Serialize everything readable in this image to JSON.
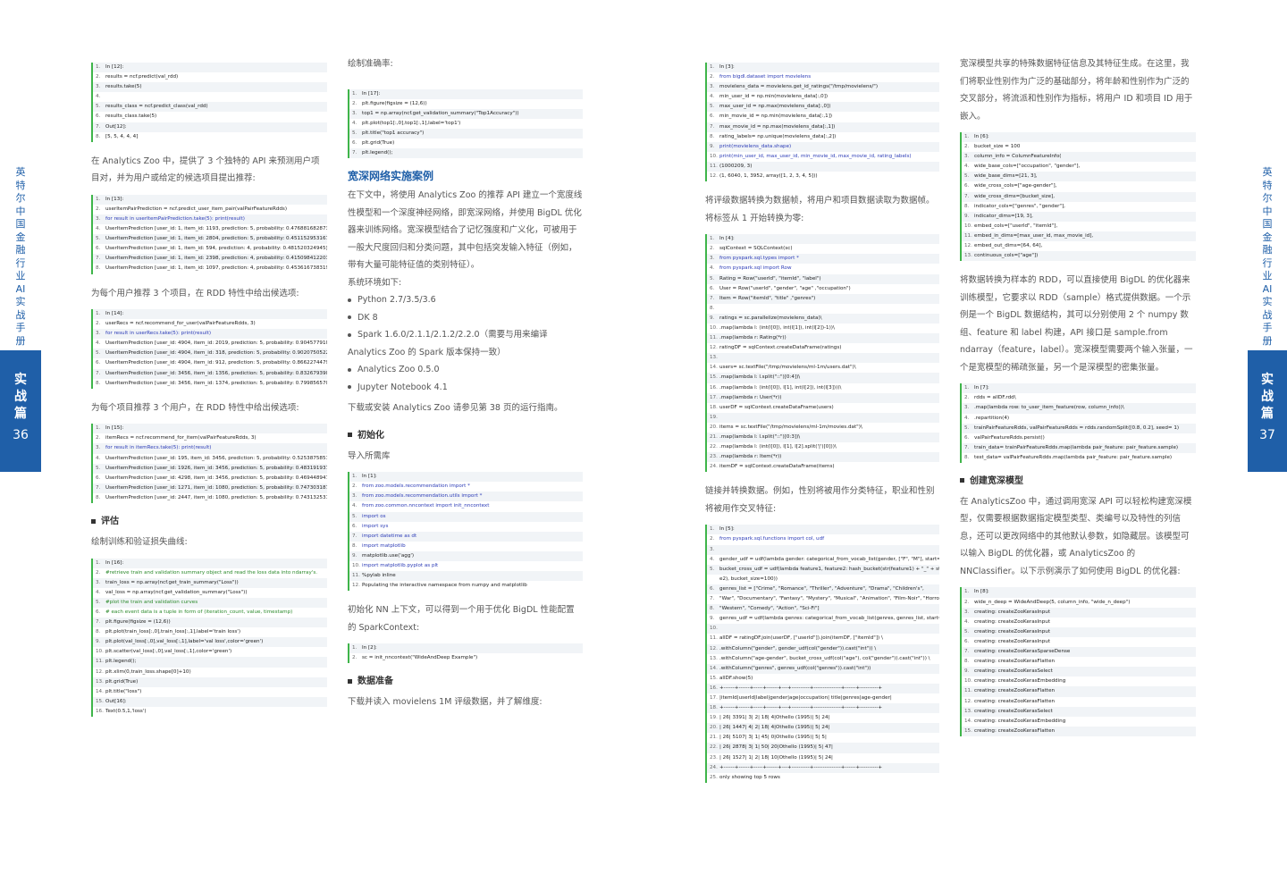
{
  "side_left": {
    "vertical_title": [
      "英",
      "特",
      "尔",
      "中",
      "国",
      "金",
      "融",
      "行",
      "业",
      "AI",
      "实",
      "战",
      "手",
      "册"
    ],
    "tab": [
      "实",
      "战",
      "篇"
    ],
    "page_number": "36"
  },
  "side_right": {
    "vertical_title": [
      "英",
      "特",
      "尔",
      "中",
      "国",
      "金",
      "融",
      "行",
      "业",
      "AI",
      "实",
      "战",
      "手",
      "册"
    ],
    "tab": [
      "实",
      "战",
      "篇"
    ],
    "page_number": "37"
  },
  "col1": {
    "code1": [
      {
        "n": "1.",
        "t": "In [12]:"
      },
      {
        "n": "2.",
        "t": "results = ncf.predict(val_rdd)"
      },
      {
        "n": "3.",
        "t": "results.take(5)"
      },
      {
        "n": "4.",
        "t": ""
      },
      {
        "n": "5.",
        "t": "results_class = ncf.predict_class(val_rdd)"
      },
      {
        "n": "6.",
        "t": "results_class.take(5)"
      },
      {
        "n": "7.",
        "t": "Out[12]:"
      },
      {
        "n": "8.",
        "t": "[5, 5, 4, 4, 4]"
      }
    ],
    "p1": "在 Analytics Zoo 中，提供了 3 个独特的 API 来预测用户项目对，并为用户或给定的候选项目提出推荐:",
    "code2": [
      {
        "n": "1.",
        "t": "In [13]:"
      },
      {
        "n": "2.",
        "t": "userItemPairPrediction = ncf.predict_user_item_pair(valPairFeatureRdds)"
      },
      {
        "n": "3.",
        "t": "for result in userItemPairPrediction.take(5): print(result)"
      },
      {
        "n": "4.",
        "t": "UserItemPrediction [user_id: 1, item_id: 1193, prediction: 5, probability: 0.476881682873]"
      },
      {
        "n": "5.",
        "t": "UserItemPrediction [user_id: 1, item_id: 2804, prediction: 5, probability: 0.451152953167]"
      },
      {
        "n": "6.",
        "t": "UserItemPrediction [user_id: 1, item_id: 594, prediction: 4, probability: 0.481520324945]"
      },
      {
        "n": "7.",
        "t": "UserItemPrediction [user_id: 1, item_id: 2398, prediction: 4, probability: 0.415098412203]"
      },
      {
        "n": "8.",
        "t": "UserItemPrediction [user_id: 1, item_id: 1097, prediction: 4, probability: 0.453616738319]"
      }
    ],
    "p2": "为每个用户推荐 3 个项目，在 RDD 特性中给出候选项:",
    "code3": [
      {
        "n": "1.",
        "t": "In [14]:"
      },
      {
        "n": "2.",
        "t": "userRecs = ncf.recommend_for_user(valPairFeatureRdds, 3)"
      },
      {
        "n": "3.",
        "t": "for result in userRecs.take(5): print(result)"
      },
      {
        "n": "4.",
        "t": "UserItemPrediction [user_id: 4904, item_id: 2019, prediction: 5, probability: 0.9045779106]"
      },
      {
        "n": "5.",
        "t": "UserItemPrediction [user_id: 4904, item_id: 318, prediction: 5, probability: 0.902075052261]"
      },
      {
        "n": "6.",
        "t": "UserItemPrediction [user_id: 4904, item_id: 912, prediction: 5, probability: 0.866227447987]"
      },
      {
        "n": "7.",
        "t": "UserItemPrediction [user_id: 3456, item_id: 1356, prediction: 5, probability: 0.832679390907]"
      },
      {
        "n": "8.",
        "t": "UserItemPrediction [user_id: 3456, item_id: 1374, prediction: 5, probability: 0.799856570099]"
      }
    ],
    "p3": "为每个项目推荐 3 个用户，在 RDD 特性中给出候选项:",
    "code4": [
      {
        "n": "1.",
        "t": "In [15]:"
      },
      {
        "n": "2.",
        "t": "itemRecs = ncf.recommend_for_item(valPairFeatureRdds, 3)"
      },
      {
        "n": "3.",
        "t": "for result in itemRecs.take(5): print(result)"
      },
      {
        "n": "4.",
        "t": "UserItemPrediction [user_id: 195, item_id: 3456, prediction: 5, probability: 0.525387585163]"
      },
      {
        "n": "5.",
        "t": "UserItemPrediction [user_id: 1926, item_id: 3456, prediction: 5, probability: 0.483191937208]"
      },
      {
        "n": "6.",
        "t": "UserItemPrediction [user_id: 4298, item_id: 3456, prediction: 5, probability: 0.469448947532]"
      },
      {
        "n": "7.",
        "t": "UserItemPrediction [user_id: 1271, item_id: 1080, prediction: 5, probability: 0.747303187847]"
      },
      {
        "n": "8.",
        "t": "UserItemPrediction [user_id: 2447, item_id: 1080, prediction: 5, probability: 0.743132531643]"
      }
    ],
    "h_eval": "评估",
    "p4": "绘制训练和验证损失曲线:",
    "code5": [
      {
        "n": "1.",
        "t": "In [16]:"
      },
      {
        "n": "2.",
        "t": "#retrieve train and validation summary object and read the loss data into ndarray's."
      },
      {
        "n": "3.",
        "t": "train_loss = np.array(ncf.get_train_summary(\"Loss\"))"
      },
      {
        "n": "4.",
        "t": "val_loss = np.array(ncf.get_validation_summary(\"Loss\"))"
      },
      {
        "n": "5.",
        "t": "#plot the train and validation curves"
      },
      {
        "n": "6.",
        "t": "# each event data is a tuple in form of (iteration_count, value, timestamp)"
      },
      {
        "n": "7.",
        "t": "plt.figure(figsize = (12,6))"
      },
      {
        "n": "8.",
        "t": "plt.plot(train_loss[:,0],train_loss[:,1],label='train loss')"
      },
      {
        "n": "9.",
        "t": "plt.plot(val_loss[:,0],val_loss[:,1],label='val loss',color='green')"
      },
      {
        "n": "10.",
        "t": "plt.scatter(val_loss[:,0],val_loss[:,1],color='green')"
      },
      {
        "n": "11.",
        "t": "plt.legend();"
      },
      {
        "n": "12.",
        "t": "plt.xlim(0,train_loss.shape[0]+10)"
      },
      {
        "n": "13.",
        "t": "plt.grid(True)"
      },
      {
        "n": "14.",
        "t": "plt.title(\"loss\")"
      },
      {
        "n": "15.",
        "t": "Out[16]:"
      },
      {
        "n": "16.",
        "t": "Text(0.5,1,'loss')"
      }
    ]
  },
  "col2": {
    "p1": "绘制准确率:",
    "code1": [
      {
        "n": "1.",
        "t": "In [17]:"
      },
      {
        "n": "2.",
        "t": "plt.figure(figsize = (12,6))"
      },
      {
        "n": "3.",
        "t": "top1 = np.array(ncf.get_validation_summary(\"Top1Accuracy\"))"
      },
      {
        "n": "4.",
        "t": "plt.plot(top1[:,0],top1[:,1],label='top1')"
      },
      {
        "n": "5.",
        "t": "plt.title(\"top1 accuracy\")"
      },
      {
        "n": "6.",
        "t": "plt.grid(True)"
      },
      {
        "n": "7.",
        "t": "plt.legend();"
      }
    ],
    "h_case": "宽深网络实施案例",
    "p2": "在下文中，将使用 Analytics Zoo 的推荐 API 建立一个宽度线性模型和一个深度神经网络，即宽深网络，并使用 BigDL 优化器来训练网络。宽深模型结合了记忆强度和广义化，可被用于一般大尺度回归和分类问题，其中包括突发输入特征（例如，带有大量可能特征值的类别特征）。",
    "p3": "系统环境如下:",
    "bullets": [
      "Python 2.7/3.5/3.6",
      "DK 8",
      "Spark 1.6.0/2.1.1/2.1.2/2.2.0（需要与用来编译 Analytics Zoo 的 Spark 版本保持一致）",
      "Analytics Zoo 0.5.0",
      "Jupyter Notebook 4.1"
    ],
    "p4": "下载或安装 Analytics Zoo 请参见第 38 页的运行指南。",
    "h_init": "初始化",
    "p5": "导入所需库",
    "code2": [
      {
        "n": "1.",
        "t": "In [1]:"
      },
      {
        "n": "2.",
        "t": "from zoo.models.recommendation import *"
      },
      {
        "n": "3.",
        "t": "from zoo.models.recommendation.utils import *"
      },
      {
        "n": "4.",
        "t": "from zoo.common.nncontext import init_nncontext"
      },
      {
        "n": "5.",
        "t": "import os"
      },
      {
        "n": "6.",
        "t": "import sys"
      },
      {
        "n": "7.",
        "t": "import datetime as dt"
      },
      {
        "n": "8.",
        "t": "import matplotlib"
      },
      {
        "n": "9.",
        "t": "matplotlib.use('agg')"
      },
      {
        "n": "10.",
        "t": "import matplotlib.pyplot as plt"
      },
      {
        "n": "11.",
        "t": "%pylab inline"
      },
      {
        "n": "12.",
        "t": "Populating the interactive namespace from numpy and matplotlib"
      }
    ],
    "p6": "初始化 NN 上下文，可以得到一个用于优化 BigDL 性能配置的 SparkContext:",
    "code3": [
      {
        "n": "1.",
        "t": "In [2]:"
      },
      {
        "n": "2.",
        "t": "sc = init_nncontext(\"WideAndDeep Example\")"
      }
    ],
    "h_data": "数据准备",
    "p7": "下载并读入 movielens 1M 评级数据，并了解维度:"
  },
  "col3": {
    "code1": [
      {
        "n": "1.",
        "t": "In [3]:"
      },
      {
        "n": "2.",
        "t": "from bigdl.dataset import movielens"
      },
      {
        "n": "3.",
        "t": "movielens_data = movielens.get_id_ratings(\"/tmp/movielens/\")"
      },
      {
        "n": "4.",
        "t": "min_user_id = np.min(movielens_data[:,0])"
      },
      {
        "n": "5.",
        "t": "max_user_id = np.max(movielens_data[:,0])"
      },
      {
        "n": "6.",
        "t": "min_movie_id = np.min(movielens_data[:,1])"
      },
      {
        "n": "7.",
        "t": "max_movie_id = np.max(movielens_data[:,1])"
      },
      {
        "n": "8.",
        "t": "rating_labels= np.unique(movielens_data[:,2])"
      },
      {
        "n": "9.",
        "t": "print(movielens_data.shape)"
      },
      {
        "n": "10.",
        "t": "print(min_user_id, max_user_id, min_movie_id, max_movie_id, rating_labels)"
      },
      {
        "n": "11.",
        "t": "(1000209, 3)"
      },
      {
        "n": "12.",
        "t": "(1, 6040, 1, 3952, array([1, 2, 3, 4, 5]))"
      }
    ],
    "p1": "将评级数据转换为数据帧，将用户和项目数据读取为数据帧。将标签从 1 开始转换为零:",
    "code2": [
      {
        "n": "1.",
        "t": "In [4]:"
      },
      {
        "n": "2.",
        "t": "sqlContext = SQLContext(sc)"
      },
      {
        "n": "3.",
        "t": "from pyspark.sql.types import *"
      },
      {
        "n": "4.",
        "t": "from pyspark.sql import Row"
      },
      {
        "n": "5.",
        "t": "Rating = Row(\"userId\", \"itemId\", \"label\")"
      },
      {
        "n": "6.",
        "t": "User = Row(\"userId\", \"gender\", \"age\" ,\"occupation\")"
      },
      {
        "n": "7.",
        "t": "Item = Row(\"itemId\", \"title\" ,\"genres\")"
      },
      {
        "n": "8.",
        "t": ""
      },
      {
        "n": "9.",
        "t": "ratings = sc.parallelize(movielens_data)\\"
      },
      {
        "n": "10.",
        "t": "    .map(lambda l: (int(l[0]), int(l[1]), int(l[2])-1))\\"
      },
      {
        "n": "11.",
        "t": "    .map(lambda r: Rating(*r))"
      },
      {
        "n": "12.",
        "t": "ratingDF = sqlContext.createDataFrame(ratings)"
      },
      {
        "n": "13.",
        "t": ""
      },
      {
        "n": "14.",
        "t": "users= sc.textFile(\"/tmp/movielens/ml-1m/users.dat\")\\"
      },
      {
        "n": "15.",
        "t": "    .map(lambda l: l.split(\"::\")[0:4])\\"
      },
      {
        "n": "16.",
        "t": "    .map(lambda l: (int(l[0]), l[1], int(l[2]), int(l[3])))\\"
      },
      {
        "n": "17.",
        "t": "    .map(lambda r: User(*r))"
      },
      {
        "n": "18.",
        "t": "userDF = sqlContext.createDataFrame(users)"
      },
      {
        "n": "19.",
        "t": ""
      },
      {
        "n": "20.",
        "t": "items = sc.textFile(\"/tmp/movielens/ml-1m/movies.dat\")\\"
      },
      {
        "n": "21.",
        "t": "    .map(lambda l: l.split(\"::\")[0:3])\\"
      },
      {
        "n": "22.",
        "t": "    .map(lambda l: (int(l[0]), l[1], l[2].split('|')[0]))\\"
      },
      {
        "n": "23.",
        "t": "    .map(lambda r: Item(*r))"
      },
      {
        "n": "24.",
        "t": "itemDF = sqlContext.createDataFrame(items)"
      }
    ],
    "p2": "链接并转换数据。例如，性别将被用作分类特征，职业和性别将被用作交叉特征:",
    "code3": [
      {
        "n": "1.",
        "t": "In [5]:"
      },
      {
        "n": "2.",
        "t": "from pyspark.sql.functions import col, udf"
      },
      {
        "n": "3.",
        "t": ""
      },
      {
        "n": "4.",
        "t": "gender_udf = udf(lambda gender: categorical_from_vocab_list(gender, [\"F\", \"M\"], start=1))"
      },
      {
        "n": "5.",
        "t": "bucket_cross_udf = udf(lambda feature1, feature2: hash_bucket(str(feature1) + \"_\" + str(featur"
      },
      {
        "n": "",
        "t": "e2), bucket_size=100))"
      },
      {
        "n": "6.",
        "t": "genres_list = [\"Crime\", \"Romance\", \"Thriller\", \"Adventure\", \"Drama\", \"Children's\","
      },
      {
        "n": "7.",
        "t": "      \"War\", \"Documentary\", \"Fantasy\", \"Mystery\", \"Musical\", \"Animation\", \"Film-Noir\", \"Horror\","
      },
      {
        "n": "8.",
        "t": "      \"Western\", \"Comedy\", \"Action\", \"Sci-Fi\"]"
      },
      {
        "n": "9.",
        "t": "genres_udf = udf(lambda genres: categorical_from_vocab_list(genres, genres_list, start=1))"
      },
      {
        "n": "10.",
        "t": ""
      },
      {
        "n": "11.",
        "t": "allDF = ratingDF.join(userDF, [\"userId\"]).join(itemDF, [\"itemId\"]) \\"
      },
      {
        "n": "12.",
        "t": "      .withColumn(\"gender\", gender_udf(col(\"gender\")).cast(\"int\")) \\"
      },
      {
        "n": "13.",
        "t": "      .withColumn(\"age-gender\", bucket_cross_udf(col(\"age\"), col(\"gender\")).cast(\"int\")) \\"
      },
      {
        "n": "14.",
        "t": "      .withColumn(\"genres\", genres_udf(col(\"genres\")).cast(\"int\"))"
      },
      {
        "n": "15.",
        "t": "allDF.show(5)"
      },
      {
        "n": "16.",
        "t": "+------+------+-----+------+---+----------+---------------+------+----------+"
      },
      {
        "n": "17.",
        "t": "|itemId|userId|label|gender|age|occupation|          title|genres|age-gender|"
      },
      {
        "n": "18.",
        "t": "+------+------+-----+------+---+----------+---------------+------+----------+"
      },
      {
        "n": "19.",
        "t": "|    26|  3391|    3|     2| 18|         4|Othello (1995)|     5|        24|"
      },
      {
        "n": "20.",
        "t": "|    26|  1447|    4|     2| 18|         4|Othello (1995)|     5|        24|"
      },
      {
        "n": "21.",
        "t": "|    26|  5107|    3|     1| 45|         0|Othello (1995)|     5|         5|"
      },
      {
        "n": "22.",
        "t": "|    26|  2878|    3|     1| 50|        20|Othello (1995)|     5|        47|"
      },
      {
        "n": "23.",
        "t": "|    26|  1527|    1|     2| 18|        10|Othello (1995)|     5|        24|"
      },
      {
        "n": "24.",
        "t": "+------+------+-----+------+---+----------+---------------+------+----------+"
      },
      {
        "n": "25.",
        "t": "only showing top 5 rows"
      }
    ]
  },
  "col4": {
    "p1": "宽深模型共享的特殊数据特征信息及其特征生成。在这里，我们将职业性别作为广泛的基础部分，将年龄和性别作为广泛的交叉部分，将流派和性别作为指标，将用户 ID 和项目 ID 用于嵌入。",
    "code1": [
      {
        "n": "1.",
        "t": "In [6]:"
      },
      {
        "n": "2.",
        "t": "bucket_size = 100"
      },
      {
        "n": "3.",
        "t": "column_info = ColumnFeatureInfo("
      },
      {
        "n": "4.",
        "t": "        wide_base_cols=[\"occupation\", \"gender\"],"
      },
      {
        "n": "5.",
        "t": "        wide_base_dims=[21, 3],"
      },
      {
        "n": "6.",
        "t": "        wide_cross_cols=[\"age-gender\"],"
      },
      {
        "n": "7.",
        "t": "        wide_cross_dims=[bucket_size],"
      },
      {
        "n": "8.",
        "t": "        indicator_cols=[\"genres\", \"gender\"],"
      },
      {
        "n": "9.",
        "t": "        indicator_dims=[19, 3],"
      },
      {
        "n": "10.",
        "t": "        embed_cols=[\"userId\", \"itemId\"],"
      },
      {
        "n": "11.",
        "t": "        embed_in_dims=[max_user_id, max_movie_id],"
      },
      {
        "n": "12.",
        "t": "        embed_out_dims=[64, 64],"
      },
      {
        "n": "13.",
        "t": "        continuous_cols=[\"age\"])"
      }
    ],
    "p2": "将数据转换为样本的 RDD，可以直接使用 BigDL 的优化器来训练模型，它要求以 RDD（sample）格式提供数据。一个示例是一个 BigDL 数据结构，其可以分别使用 2 个 numpy 数组、feature 和 label 构建，API 接口是 sample.from ndarray（feature，label）。宽深模型需要两个输入张量，一个是宽模型的稀疏张量，另一个是深模型的密集张量。",
    "code2": [
      {
        "n": "1.",
        "t": "In [7]:"
      },
      {
        "n": "2.",
        "t": "rdds = allDF.rdd\\"
      },
      {
        "n": "3.",
        "t": ".map(lambda row: to_user_item_feature(row, column_info))\\"
      },
      {
        "n": "4.",
        "t": ".repartition(4)"
      },
      {
        "n": "5.",
        "t": "trainPairFeatureRdds, valPairFeatureRdds = rdds.randomSplit([0.8, 0.2], seed= 1)"
      },
      {
        "n": "6.",
        "t": "valPairFeatureRdds.persist()"
      },
      {
        "n": "7.",
        "t": "train_data= trainPairFeatureRdds.map(lambda pair_feature: pair_feature.sample)"
      },
      {
        "n": "8.",
        "t": "test_data= valPairFeatureRdds.map(lambda pair_feature: pair_feature.sample)"
      }
    ],
    "h_build": "创建宽深模型",
    "p3": "在 AnalyticsZoo 中，通过调用宽深 API 可以轻松构建宽深模型，仅需要根据数据指定模型类型、类编号以及特性的列信息，还可以更改网络中的其他默认参数，如隐藏层。该模型可以输入 BigDL 的优化器，或 AnalyticsZoo 的 NNClassifier。以下示例演示了如何使用 BigDL 的优化器:",
    "code3": [
      {
        "n": "1.",
        "t": "In [8]:"
      },
      {
        "n": "2.",
        "t": "wide_n_deep = WideAndDeep(5, column_info, \"wide_n_deep\")"
      },
      {
        "n": "3.",
        "t": "creating: createZooKerasInput"
      },
      {
        "n": "4.",
        "t": "creating: createZooKerasInput"
      },
      {
        "n": "5.",
        "t": "creating: createZooKerasInput"
      },
      {
        "n": "6.",
        "t": "creating: createZooKerasInput"
      },
      {
        "n": "7.",
        "t": "creating: createZooKerasSparseDense"
      },
      {
        "n": "8.",
        "t": "creating: createZooKerasFlatten"
      },
      {
        "n": "9.",
        "t": "creating: createZooKerasSelect"
      },
      {
        "n": "10.",
        "t": "creating: createZooKerasEmbedding"
      },
      {
        "n": "11.",
        "t": "creating: createZooKerasFlatten"
      },
      {
        "n": "12.",
        "t": "creating: createZooKerasFlatten"
      },
      {
        "n": "13.",
        "t": "creating: createZooKerasSelect"
      },
      {
        "n": "14.",
        "t": "creating: createZooKerasEmbedding"
      },
      {
        "n": "15.",
        "t": "creating: createZooKerasFlatten"
      }
    ]
  }
}
